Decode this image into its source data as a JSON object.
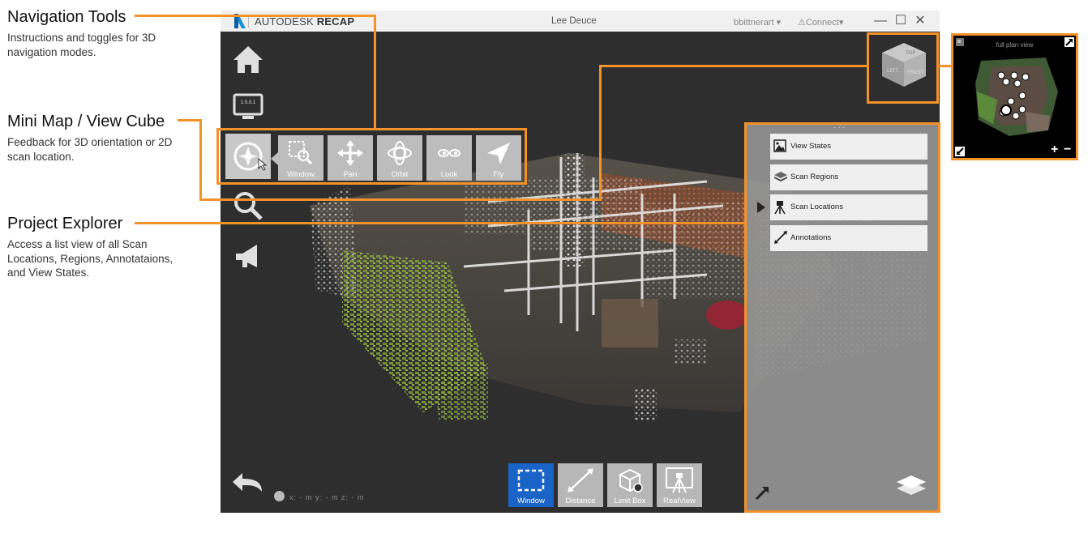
{
  "callouts": {
    "navigation_tools": {
      "title": "Navigation Tools",
      "desc": "Instructions and toggles for 3D navigation modes."
    },
    "mini_map": {
      "title": "Mini Map / View Cube",
      "desc": "Feedback for 3D orientation or 2D scan location."
    },
    "project_explorer": {
      "title": "Project Explorer",
      "desc": "Access a list view of all Scan Locations, Regions, Annotataions, and View States."
    }
  },
  "titlebar": {
    "brand_prefix": "AUTODESK",
    "brand_name": "RECAP",
    "user": "Lee Deuce",
    "account": "bbittnerart",
    "connect": "Connect"
  },
  "sidebar": {
    "items": [
      {
        "icon": "home-icon"
      },
      {
        "icon": "monitor-icon",
        "text": "1.0.0.1"
      },
      {
        "icon": "compass-icon"
      },
      {
        "icon": "search-icon"
      },
      {
        "icon": "megaphone-icon"
      }
    ]
  },
  "nav_tools": [
    {
      "label": "Window",
      "icon": "window-zoom-icon"
    },
    {
      "label": "Pan",
      "icon": "pan-icon"
    },
    {
      "label": "Orbit",
      "icon": "orbit-icon"
    },
    {
      "label": "Look",
      "icon": "look-icon"
    },
    {
      "label": "Fly",
      "icon": "fly-icon"
    }
  ],
  "view_cube": {
    "faces": [
      "TOP",
      "LEFT",
      "FRONT"
    ]
  },
  "coords": {
    "x": "x: - m",
    "y": "y: - m",
    "z": "z: - m"
  },
  "bottom_tools": [
    {
      "label": "Window",
      "active": true
    },
    {
      "label": "Distance",
      "active": false
    },
    {
      "label": "Limit Box",
      "active": false
    },
    {
      "label": "RealView",
      "active": false
    }
  ],
  "project_explorer": {
    "items": [
      {
        "label": "View States"
      },
      {
        "label": "Scan Regions"
      },
      {
        "label": "Scan Locations",
        "selected": true
      },
      {
        "label": "Annotations"
      }
    ]
  },
  "minimap": {
    "title": "full plan view"
  },
  "colors": {
    "accent": "#f4922a",
    "active_tool": "#1a64c8",
    "viewport_bg": "#2e2e2e"
  }
}
